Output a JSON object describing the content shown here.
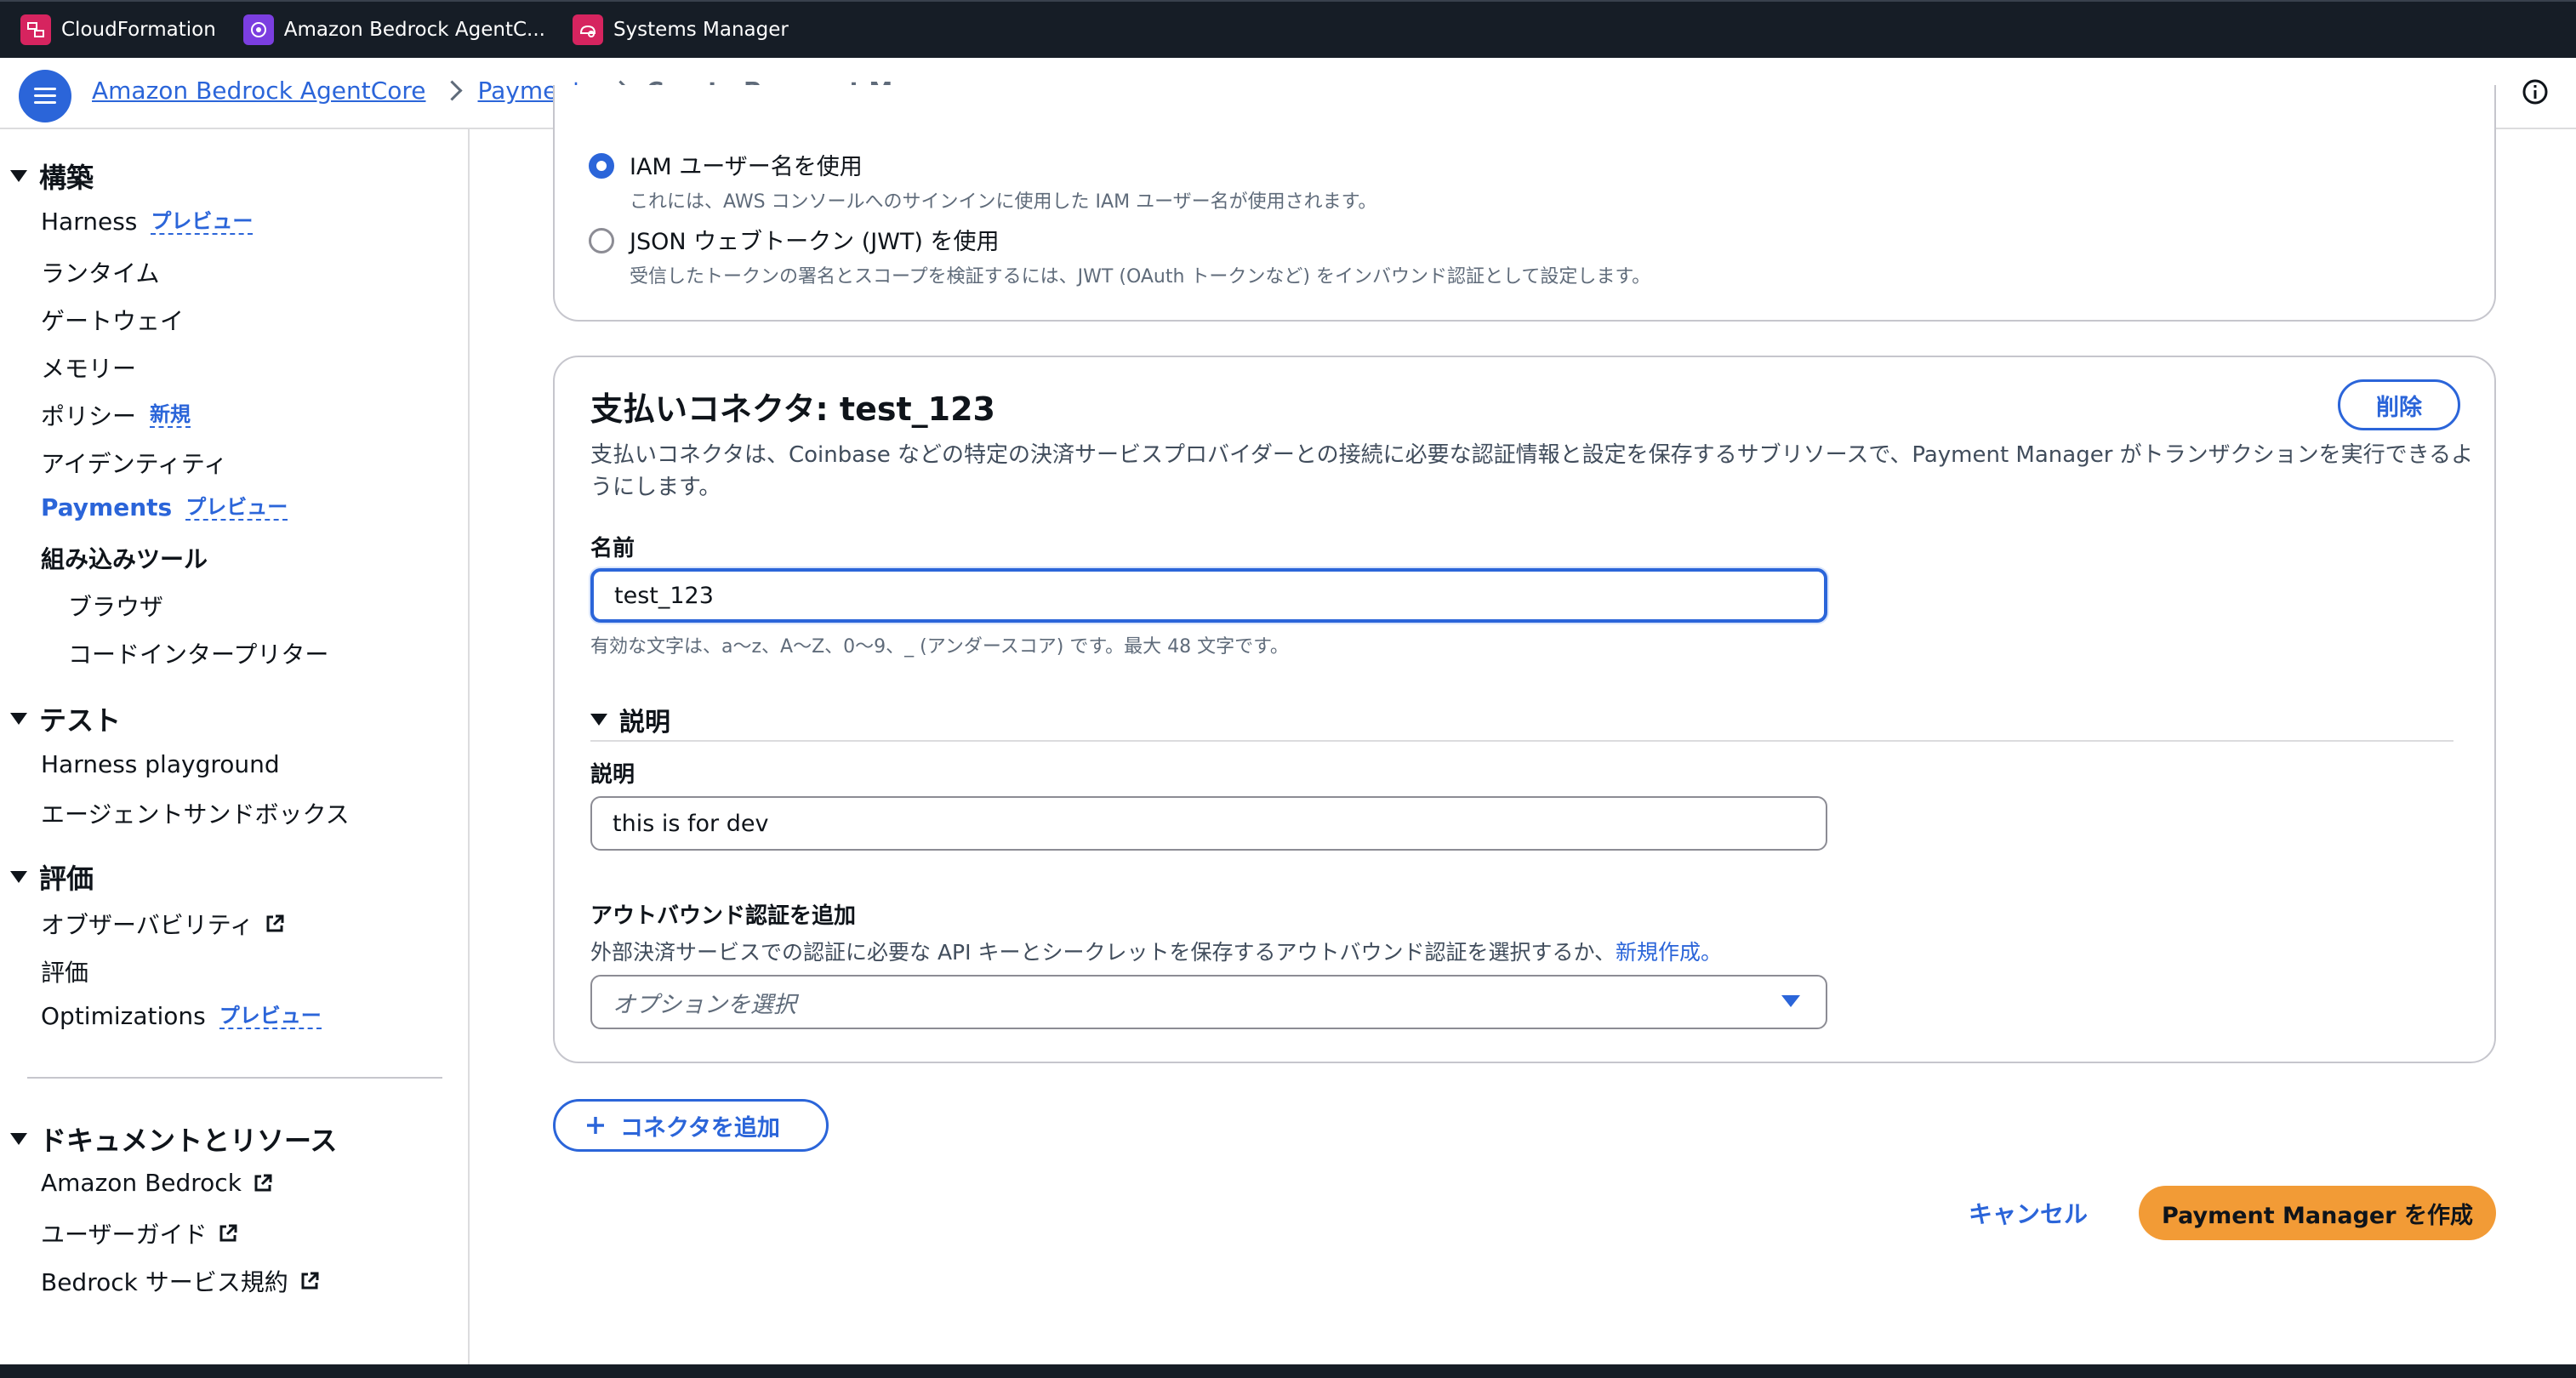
{
  "favorites_bar": {
    "items": [
      {
        "label": "CloudFormation",
        "icon": "cloudformation-icon",
        "color": "#d6245f"
      },
      {
        "label": "Amazon Bedrock AgentC...",
        "icon": "bedrock-icon",
        "color": "#7b3ee0"
      },
      {
        "label": "Systems Manager",
        "icon": "systems-manager-icon",
        "color": "#d6245f"
      }
    ]
  },
  "header": {
    "breadcrumbs": [
      "Amazon Bedrock AgentCore",
      "Payments"
    ],
    "current": "Create Payment Manager",
    "menu_icon": "hamburger-icon",
    "info_icon": "info-icon"
  },
  "sidebar": {
    "sections": [
      {
        "title": "構築"
      },
      {
        "title": "テスト"
      },
      {
        "title": "評価"
      },
      {
        "title": "ドキュメントとリソース"
      }
    ],
    "build_items": [
      {
        "label": "Harness",
        "badge": "プレビュー"
      },
      {
        "label": "ランタイム"
      },
      {
        "label": "ゲートウェイ"
      },
      {
        "label": "メモリー"
      },
      {
        "label": "ポリシー",
        "badge": "新規"
      },
      {
        "label": "アイデンティティ"
      },
      {
        "label": "Payments",
        "badge": "プレビュー"
      },
      {
        "label": "組み込みツール"
      },
      {
        "label": "ブラウザ"
      },
      {
        "label": "コードインタープリター"
      }
    ],
    "test_items": [
      {
        "label": "Harness playground"
      },
      {
        "label": "エージェントサンドボックス"
      }
    ],
    "eval_items": [
      {
        "label": "オブザーバビリティ"
      },
      {
        "label": "評価"
      },
      {
        "label": "Optimizations",
        "badge": "プレビュー"
      }
    ],
    "doc_items": [
      {
        "label": "Amazon Bedrock"
      },
      {
        "label": "ユーザーガイド"
      },
      {
        "label": "Bedrock サービス規約"
      }
    ]
  },
  "inbound_auth": {
    "options": [
      {
        "label": "IAM ユーザー名を使用",
        "description": "これには、AWS コンソールへのサインインに使用した IAM ユーザー名が使用されます。",
        "selected": true
      },
      {
        "label": "JSON ウェブトークン (JWT) を使用",
        "description": "受信したトークンの署名とスコープを検証するには、JWT (OAuth トークンなど) をインバウンド認証として設定します。",
        "selected": false
      }
    ]
  },
  "connector": {
    "title": "支払いコネクタ: test_123",
    "delete_label": "削除",
    "description": "支払いコネクタは、Coinbase などの特定の決済サービスプロバイダーとの接続に必要な認証情報と設定を保存するサブリソースで、Payment Manager がトランザクションを実行できるようにします。",
    "name_label": "名前",
    "name_value": "test_123",
    "name_hint": "有効な文字は、a〜z、A〜Z、0〜9、_ (アンダースコア) です。最大 48 文字です。",
    "desc_section": "説明",
    "desc_label": "説明",
    "desc_value": "this is for dev",
    "outbound_label": "アウトバウンド認証を追加",
    "outbound_hint": "外部決済サービスでの認証に必要な API キーとシークレットを保存するアウトバウンド認証を選択するか、",
    "outbound_link": "新規作成。",
    "select_placeholder": "オプションを選択"
  },
  "actions": {
    "add_connector": "コネクタを追加",
    "cancel": "キャンセル",
    "create": "Payment Manager を作成"
  },
  "colors": {
    "accent": "#2b65d9",
    "primary_button": "#f29b36",
    "topbar": "#161d26"
  }
}
